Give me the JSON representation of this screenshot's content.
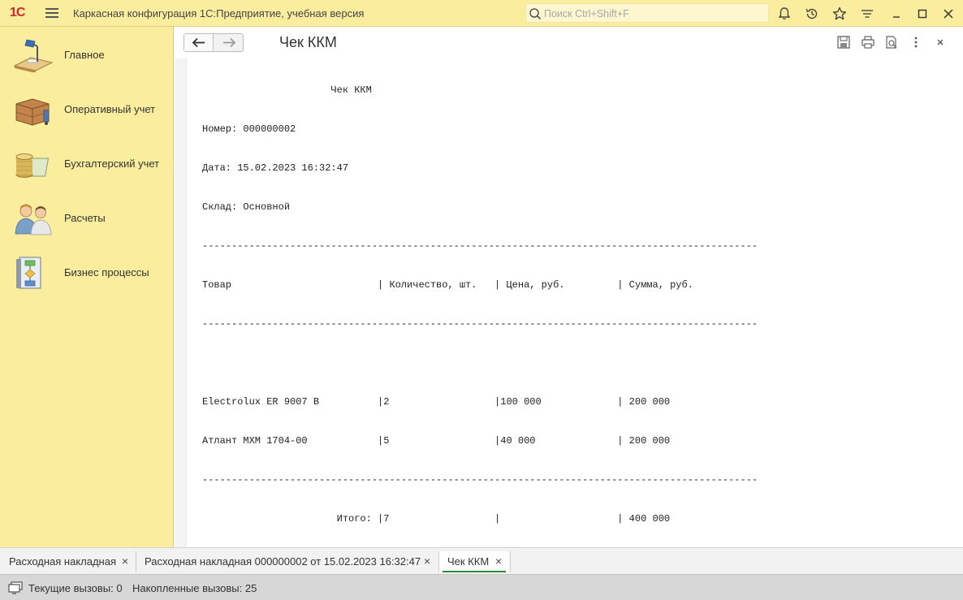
{
  "titlebar": {
    "logo": "1С",
    "app_title": "Каркасная конфигурация 1С:Предприятие, учебная версия",
    "search_placeholder": "Поиск Ctrl+Shift+F",
    "icons": [
      "bell-icon",
      "history-icon",
      "star-icon",
      "settings-menu-icon",
      "minimize-icon",
      "maximize-icon",
      "close-icon"
    ]
  },
  "sidebar": {
    "items": [
      {
        "label": "Главное",
        "icon": "desk-lamp-icon"
      },
      {
        "label": "Оперативный учет",
        "icon": "boxes-icon"
      },
      {
        "label": "Бухгалтерский учет",
        "icon": "coins-icon"
      },
      {
        "label": "Расчеты",
        "icon": "people-icon"
      },
      {
        "label": "Бизнес процессы",
        "icon": "flowchart-icon"
      }
    ]
  },
  "form": {
    "title": "Чек ККМ",
    "actions": [
      "save-icon",
      "print-icon",
      "preview-icon",
      "more-icon",
      "close-icon"
    ]
  },
  "document": {
    "lines": [
      "                      Чек ККМ",
      "Номер: 000000002",
      "Дата: 15.02.2023 16:32:47",
      "Склад: Основной",
      "-----------------------------------------------------------------------------------------------",
      "Товар                         | Количество, шт.   | Цена, руб.         | Сумма, руб.",
      "-----------------------------------------------------------------------------------------------",
      "",
      "Electrolux ER 9007 B          |2                  |100 000             | 200 000",
      "Атлант МХМ 1704-00            |5                  |40 000              | 200 000",
      "-----------------------------------------------------------------------------------------------",
      "                       Итого: |7                  |                    | 400 000"
    ]
  },
  "tabs": [
    {
      "label": "Расходная накладная",
      "close": "×",
      "active": false
    },
    {
      "label": "Расходная накладная 000000002 от 15.02.2023 16:32:47",
      "close": "×",
      "active": false
    },
    {
      "label": "Чек ККМ",
      "close": "×",
      "active": true
    }
  ],
  "status": {
    "current_calls": "Текущие вызовы: 0",
    "accumulated_calls": "Накопленные вызовы: 25"
  },
  "colors": {
    "panel_yellow": "#fbed9e",
    "logo_red": "#d6262a",
    "active_tab_underline": "#2e8b3e"
  }
}
